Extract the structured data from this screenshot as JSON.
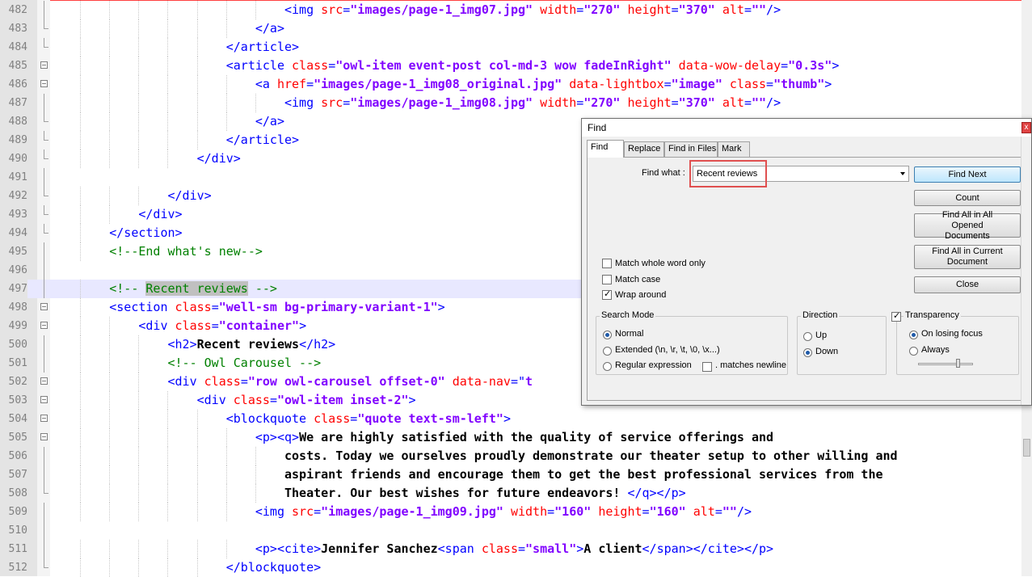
{
  "editor": {
    "lines": [
      {
        "num": "482",
        "fold": "line",
        "tokens": [
          [
            "pad",
            "                                "
          ],
          [
            "tag",
            "<img "
          ],
          [
            "attr",
            "src"
          ],
          [
            "tag",
            "="
          ],
          [
            "val",
            "\"images/page-1_img07.jpg\""
          ],
          [
            "tag",
            " "
          ],
          [
            "attr",
            "width"
          ],
          [
            "tag",
            "="
          ],
          [
            "val",
            "\"270\""
          ],
          [
            "tag",
            " "
          ],
          [
            "attr",
            "height"
          ],
          [
            "tag",
            "="
          ],
          [
            "val",
            "\"370\""
          ],
          [
            "tag",
            " "
          ],
          [
            "attr",
            "alt"
          ],
          [
            "tag",
            "="
          ],
          [
            "val",
            "\"\""
          ],
          [
            "tag",
            "/>"
          ]
        ]
      },
      {
        "num": "483",
        "fold": "end",
        "tokens": [
          [
            "pad",
            "                            "
          ],
          [
            "tag",
            "</a>"
          ]
        ]
      },
      {
        "num": "484",
        "fold": "end",
        "tokens": [
          [
            "pad",
            "                        "
          ],
          [
            "tag",
            "</article>"
          ]
        ]
      },
      {
        "num": "485",
        "fold": "box",
        "tokens": [
          [
            "pad",
            "                        "
          ],
          [
            "tag",
            "<article "
          ],
          [
            "attr",
            "class"
          ],
          [
            "tag",
            "="
          ],
          [
            "val",
            "\"owl-item event-post col-md-3 wow fadeInRight\""
          ],
          [
            "tag",
            " "
          ],
          [
            "attr",
            "data-wow-delay"
          ],
          [
            "tag",
            "="
          ],
          [
            "val",
            "\"0.3s\""
          ],
          [
            "tag",
            ">"
          ]
        ]
      },
      {
        "num": "486",
        "fold": "box",
        "tokens": [
          [
            "pad",
            "                            "
          ],
          [
            "tag",
            "<a "
          ],
          [
            "attr",
            "href"
          ],
          [
            "tag",
            "="
          ],
          [
            "val",
            "\"images/page-1_img08_original.jpg\""
          ],
          [
            "tag",
            " "
          ],
          [
            "attr",
            "data-lightbox"
          ],
          [
            "tag",
            "="
          ],
          [
            "val",
            "\"image\""
          ],
          [
            "tag",
            " "
          ],
          [
            "attr",
            "class"
          ],
          [
            "tag",
            "="
          ],
          [
            "val",
            "\"thumb\""
          ],
          [
            "tag",
            ">"
          ]
        ]
      },
      {
        "num": "487",
        "fold": "line",
        "tokens": [
          [
            "pad",
            "                                "
          ],
          [
            "tag",
            "<img "
          ],
          [
            "attr",
            "src"
          ],
          [
            "tag",
            "="
          ],
          [
            "val",
            "\"images/page-1_img08.jpg\""
          ],
          [
            "tag",
            " "
          ],
          [
            "attr",
            "width"
          ],
          [
            "tag",
            "="
          ],
          [
            "val",
            "\"270\""
          ],
          [
            "tag",
            " "
          ],
          [
            "attr",
            "height"
          ],
          [
            "tag",
            "="
          ],
          [
            "val",
            "\"370\""
          ],
          [
            "tag",
            " "
          ],
          [
            "attr",
            "alt"
          ],
          [
            "tag",
            "="
          ],
          [
            "val",
            "\"\""
          ],
          [
            "tag",
            "/>"
          ]
        ]
      },
      {
        "num": "488",
        "fold": "end",
        "tokens": [
          [
            "pad",
            "                            "
          ],
          [
            "tag",
            "</a>"
          ]
        ]
      },
      {
        "num": "489",
        "fold": "end",
        "tokens": [
          [
            "pad",
            "                        "
          ],
          [
            "tag",
            "</article>"
          ]
        ]
      },
      {
        "num": "490",
        "fold": "end",
        "tokens": [
          [
            "pad",
            "                    "
          ],
          [
            "tag",
            "</div>"
          ]
        ]
      },
      {
        "num": "491",
        "fold": "line",
        "tokens": []
      },
      {
        "num": "492",
        "fold": "end",
        "tokens": [
          [
            "pad",
            "                "
          ],
          [
            "tag",
            "</div>"
          ]
        ]
      },
      {
        "num": "493",
        "fold": "end",
        "tokens": [
          [
            "pad",
            "            "
          ],
          [
            "tag",
            "</div>"
          ]
        ]
      },
      {
        "num": "494",
        "fold": "end",
        "tokens": [
          [
            "pad",
            "        "
          ],
          [
            "tag",
            "</section>"
          ]
        ]
      },
      {
        "num": "495",
        "fold": "line",
        "tokens": [
          [
            "pad",
            "        "
          ],
          [
            "com",
            "<!--End what's new-->"
          ]
        ]
      },
      {
        "num": "496",
        "fold": "line",
        "tokens": []
      },
      {
        "num": "497",
        "fold": "line",
        "current": true,
        "tokens": [
          [
            "pad",
            "        "
          ],
          [
            "com",
            "<!-- "
          ],
          [
            "hl",
            "Recent reviews"
          ],
          [
            "com",
            " -->"
          ]
        ]
      },
      {
        "num": "498",
        "fold": "box",
        "tokens": [
          [
            "pad",
            "        "
          ],
          [
            "tag",
            "<section "
          ],
          [
            "attr",
            "class"
          ],
          [
            "tag",
            "="
          ],
          [
            "val",
            "\"well-sm bg-primary-variant-1\""
          ],
          [
            "tag",
            ">"
          ]
        ]
      },
      {
        "num": "499",
        "fold": "box",
        "tokens": [
          [
            "pad",
            "            "
          ],
          [
            "tag",
            "<div "
          ],
          [
            "attr",
            "class"
          ],
          [
            "tag",
            "="
          ],
          [
            "val",
            "\"container\""
          ],
          [
            "tag",
            ">"
          ]
        ]
      },
      {
        "num": "500",
        "fold": "line",
        "tokens": [
          [
            "pad",
            "                "
          ],
          [
            "tag",
            "<h2>"
          ],
          [
            "txt",
            "Recent reviews"
          ],
          [
            "tag",
            "</h2>"
          ]
        ]
      },
      {
        "num": "501",
        "fold": "line",
        "tokens": [
          [
            "pad",
            "                "
          ],
          [
            "com",
            "<!-- Owl Carousel -->"
          ]
        ]
      },
      {
        "num": "502",
        "fold": "box",
        "tokens": [
          [
            "pad",
            "                "
          ],
          [
            "tag",
            "<div "
          ],
          [
            "attr",
            "class"
          ],
          [
            "tag",
            "="
          ],
          [
            "val",
            "\"row owl-carousel offset-0\""
          ],
          [
            "tag",
            " "
          ],
          [
            "attr",
            "data-nav"
          ],
          [
            "tag",
            "=\""
          ],
          [
            "val",
            "t"
          ]
        ]
      },
      {
        "num": "503",
        "fold": "box",
        "tokens": [
          [
            "pad",
            "                    "
          ],
          [
            "tag",
            "<div "
          ],
          [
            "attr",
            "class"
          ],
          [
            "tag",
            "="
          ],
          [
            "val",
            "\"owl-item inset-2\""
          ],
          [
            "tag",
            ">"
          ]
        ]
      },
      {
        "num": "504",
        "fold": "box",
        "tokens": [
          [
            "pad",
            "                        "
          ],
          [
            "tag",
            "<blockquote "
          ],
          [
            "attr",
            "class"
          ],
          [
            "tag",
            "="
          ],
          [
            "val",
            "\"quote text-sm-left\""
          ],
          [
            "tag",
            ">"
          ]
        ]
      },
      {
        "num": "505",
        "fold": "box",
        "tokens": [
          [
            "pad",
            "                            "
          ],
          [
            "tag",
            "<p><q>"
          ],
          [
            "txt",
            "We are highly satisfied with the quality of service offerings and"
          ]
        ]
      },
      {
        "num": "506",
        "fold": "line",
        "tokens": [
          [
            "pad",
            "                                "
          ],
          [
            "txt",
            "costs. Today we ourselves proudly demonstrate our theater setup to other willing and"
          ]
        ]
      },
      {
        "num": "507",
        "fold": "line",
        "tokens": [
          [
            "pad",
            "                                "
          ],
          [
            "txt",
            "aspirant friends and encourage them to get the best professional services from the"
          ]
        ]
      },
      {
        "num": "508",
        "fold": "end",
        "tokens": [
          [
            "pad",
            "                                "
          ],
          [
            "txt",
            "Theater. Our best wishes for future endeavors! "
          ],
          [
            "tag",
            "</q></p>"
          ]
        ]
      },
      {
        "num": "509",
        "fold": "line",
        "tokens": [
          [
            "pad",
            "                            "
          ],
          [
            "tag",
            "<img "
          ],
          [
            "attr",
            "src"
          ],
          [
            "tag",
            "="
          ],
          [
            "val",
            "\"images/page-1_img09.jpg\""
          ],
          [
            "tag",
            " "
          ],
          [
            "attr",
            "width"
          ],
          [
            "tag",
            "="
          ],
          [
            "val",
            "\"160\""
          ],
          [
            "tag",
            " "
          ],
          [
            "attr",
            "height"
          ],
          [
            "tag",
            "="
          ],
          [
            "val",
            "\"160\""
          ],
          [
            "tag",
            " "
          ],
          [
            "attr",
            "alt"
          ],
          [
            "tag",
            "="
          ],
          [
            "val",
            "\"\""
          ],
          [
            "tag",
            "/>"
          ]
        ]
      },
      {
        "num": "510",
        "fold": "line",
        "tokens": []
      },
      {
        "num": "511",
        "fold": "line",
        "tokens": [
          [
            "pad",
            "                            "
          ],
          [
            "tag",
            "<p><cite>"
          ],
          [
            "txt",
            "Jennifer Sanchez"
          ],
          [
            "tag",
            "<span "
          ],
          [
            "attr",
            "class"
          ],
          [
            "tag",
            "="
          ],
          [
            "val",
            "\"small\""
          ],
          [
            "tag",
            ">"
          ],
          [
            "txt",
            "A client"
          ],
          [
            "tag",
            "</span></cite></p>"
          ]
        ]
      },
      {
        "num": "512",
        "fold": "end",
        "tokens": [
          [
            "pad",
            "                        "
          ],
          [
            "tag",
            "</blockquote>"
          ]
        ]
      }
    ]
  },
  "find": {
    "title": "Find",
    "close_label": "x",
    "tabs": [
      "Find",
      "Replace",
      "Find in Files",
      "Mark"
    ],
    "active_tab": "Find",
    "find_what_label": "Find what :",
    "find_what_value": "Recent reviews",
    "buttons": {
      "find_next": "Find Next",
      "count": "Count",
      "find_all_opened": "Find All in All Opened Documents",
      "find_all_current": "Find All in Current Document",
      "close": "Close"
    },
    "options": {
      "match_whole_word": {
        "label": "Match whole word only",
        "checked": false
      },
      "match_case": {
        "label": "Match case",
        "checked": false
      },
      "wrap_around": {
        "label": "Wrap around",
        "checked": true
      }
    },
    "search_mode": {
      "title": "Search Mode",
      "normal": "Normal",
      "extended": "Extended (\\n, \\r, \\t, \\0, \\x...)",
      "regex": "Regular expression",
      "dot_newline": ". matches newline",
      "selected": "Normal"
    },
    "direction": {
      "title": "Direction",
      "up": "Up",
      "down": "Down",
      "selected": "Down"
    },
    "transparency": {
      "title": "Transparency",
      "enabled": true,
      "on_losing_focus": "On losing focus",
      "always": "Always",
      "selected": "On losing focus",
      "level": 0.75
    }
  }
}
